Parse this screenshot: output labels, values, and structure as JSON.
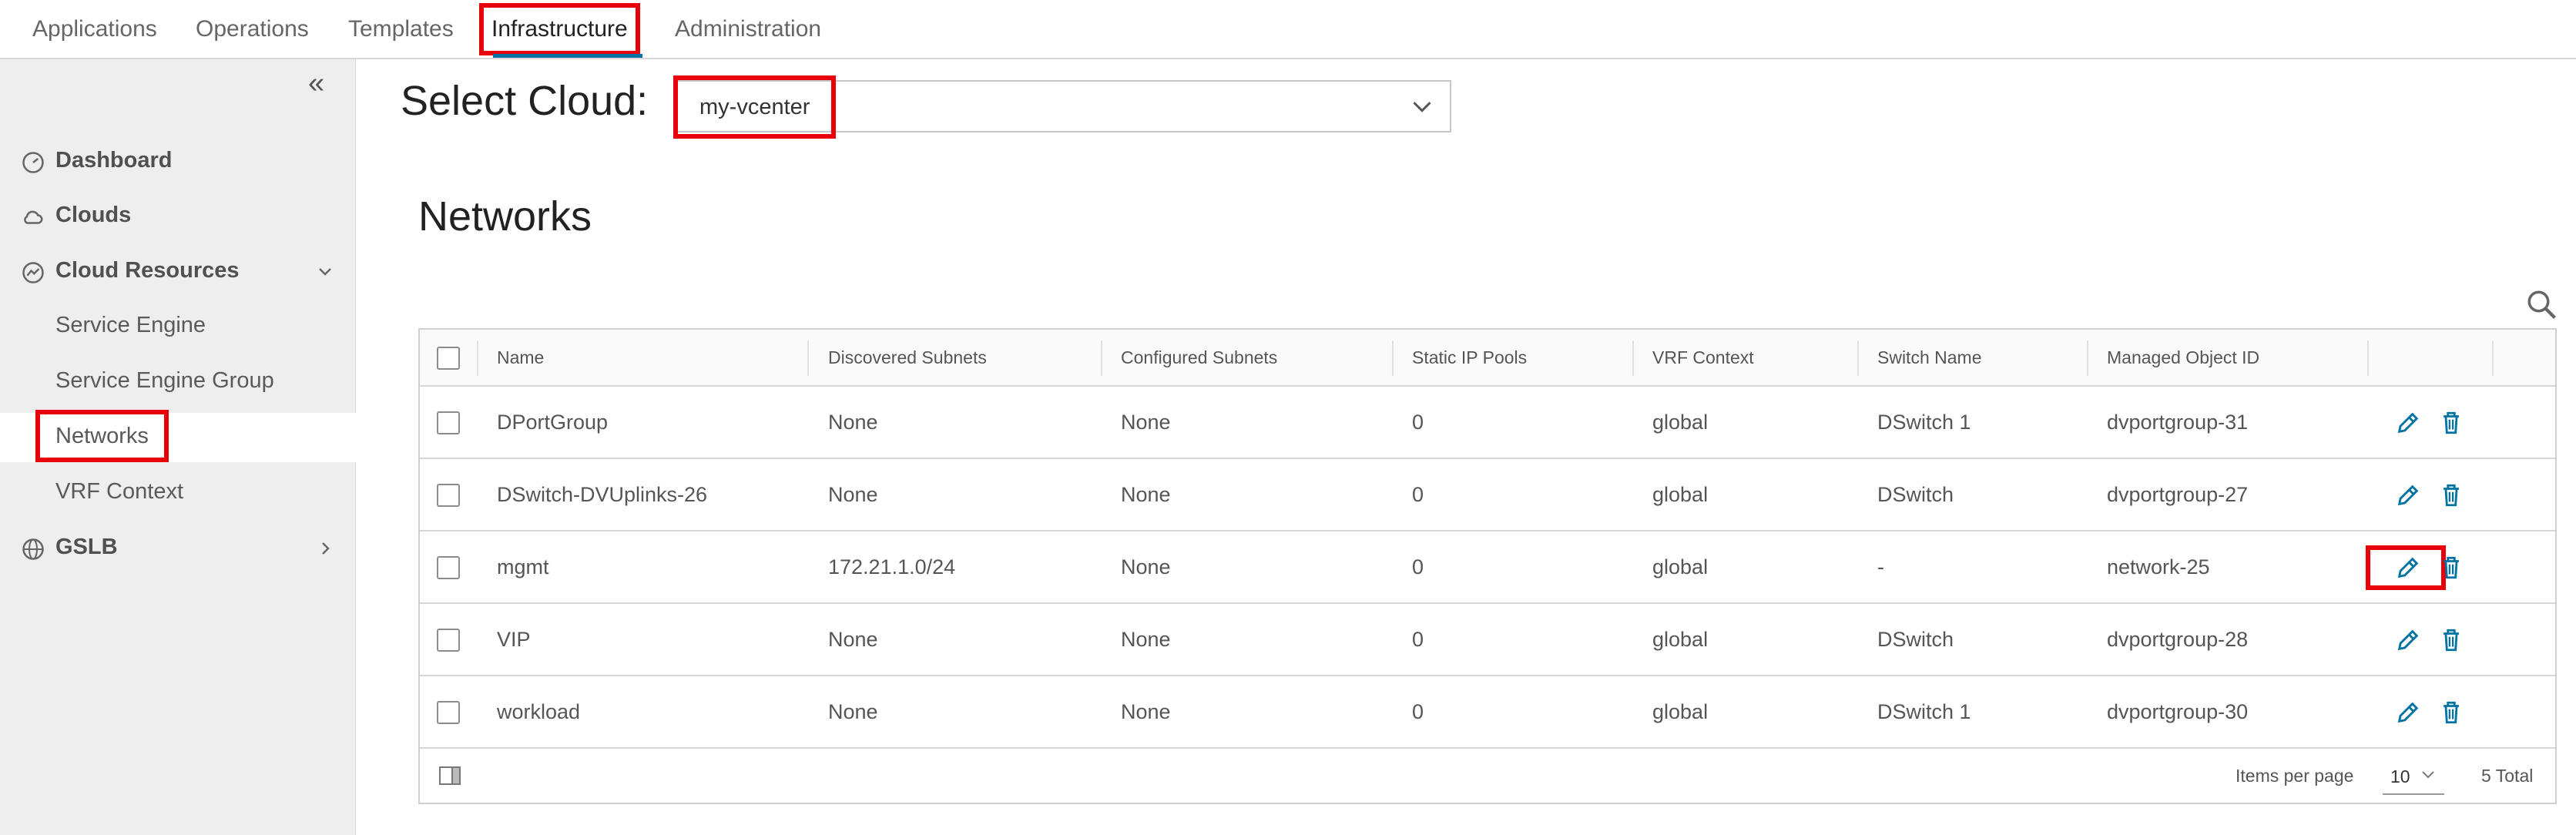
{
  "topnav": {
    "tabs": [
      {
        "label": "Applications"
      },
      {
        "label": "Operations"
      },
      {
        "label": "Templates"
      },
      {
        "label": "Infrastructure"
      },
      {
        "label": "Administration"
      }
    ],
    "active_tab": "Infrastructure"
  },
  "sidebar": {
    "items": [
      {
        "label": "Dashboard",
        "icon": "dashboard-icon"
      },
      {
        "label": "Clouds",
        "icon": "cloud-icon"
      },
      {
        "label": "Cloud Resources",
        "icon": "resources-icon",
        "expanded": true
      },
      {
        "label": "Service Engine"
      },
      {
        "label": "Service Engine Group"
      },
      {
        "label": "Networks",
        "active": true
      },
      {
        "label": "VRF Context"
      },
      {
        "label": "GSLB",
        "icon": "globe-icon",
        "expanded": false
      }
    ]
  },
  "cloud_select": {
    "label": "Select Cloud:",
    "value": "my-vcenter"
  },
  "page": {
    "title": "Networks"
  },
  "table": {
    "columns": [
      "Name",
      "Discovered Subnets",
      "Configured Subnets",
      "Static IP Pools",
      "VRF Context",
      "Switch Name",
      "Managed Object ID"
    ],
    "rows": [
      [
        "DPortGroup",
        "None",
        "None",
        "0",
        "global",
        "DSwitch 1",
        "dvportgroup-31"
      ],
      [
        "DSwitch-DVUplinks-26",
        "None",
        "None",
        "0",
        "global",
        "DSwitch",
        "dvportgroup-27"
      ],
      [
        "mgmt",
        "172.21.1.0/24",
        "None",
        "0",
        "global",
        "-",
        "network-25"
      ],
      [
        "VIP",
        "None",
        "None",
        "0",
        "global",
        "DSwitch",
        "dvportgroup-28"
      ],
      [
        "workload",
        "None",
        "None",
        "0",
        "global",
        "DSwitch 1",
        "dvportgroup-30"
      ]
    ]
  },
  "footer": {
    "items_per_page_label": "Items per page",
    "items_per_page_value": "10",
    "total": "5 Total"
  },
  "colors": {
    "accent": "#0072a3",
    "highlight": "#e8000b",
    "sidebar_bg": "#eeeeee"
  }
}
